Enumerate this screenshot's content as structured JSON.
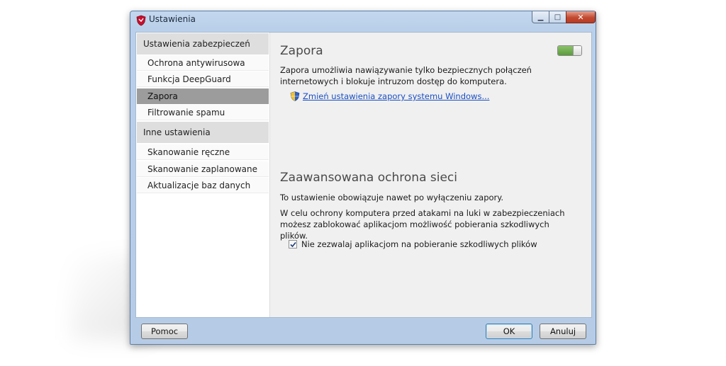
{
  "window": {
    "title": "Ustawienia",
    "controls": {
      "minimize": "▁",
      "maximize": "□",
      "close": "✕"
    }
  },
  "sidebar": {
    "group1": "Ustawienia zabezpieczeń",
    "items1": [
      "Ochrona antywirusowa",
      "Funkcja DeepGuard",
      "Zapora",
      "Filtrowanie spamu"
    ],
    "group2": "Inne ustawienia",
    "items2": [
      "Skanowanie ręczne",
      "Skanowanie zaplanowane",
      "Aktualizacje baz danych"
    ],
    "selected": "Zapora"
  },
  "main": {
    "firewall_title": "Zapora",
    "firewall_toggle_state": "on",
    "firewall_desc": "Zapora umożliwia nawiązywanie tylko bezpiecznych połączeń internetowych i blokuje intruzom dostęp do komputera.",
    "windows_firewall_link": "Zmień ustawienia zapory systemu Windows...",
    "advanced_title": "Zaawansowana ochrona sieci",
    "advanced_note": "To ustawienie obowiązuje nawet po wyłączeniu zapory.",
    "advanced_desc": "W celu ochrony komputera przed atakami na luki w zabezpieczeniach możesz zablokować aplikacjom możliwość pobierania szkodliwych plików.",
    "block_checkbox_label": "Nie zezwalaj aplikacjom na pobieranie szkodliwych plików",
    "block_checkbox_checked": true
  },
  "buttons": {
    "help": "Pomoc",
    "ok": "OK",
    "cancel": "Anuluj"
  },
  "colors": {
    "accent_link": "#1a4fc4",
    "selected_item": "#9c9c9c",
    "toggle_on": "#5a9a3c",
    "close_button": "#c24a31"
  }
}
